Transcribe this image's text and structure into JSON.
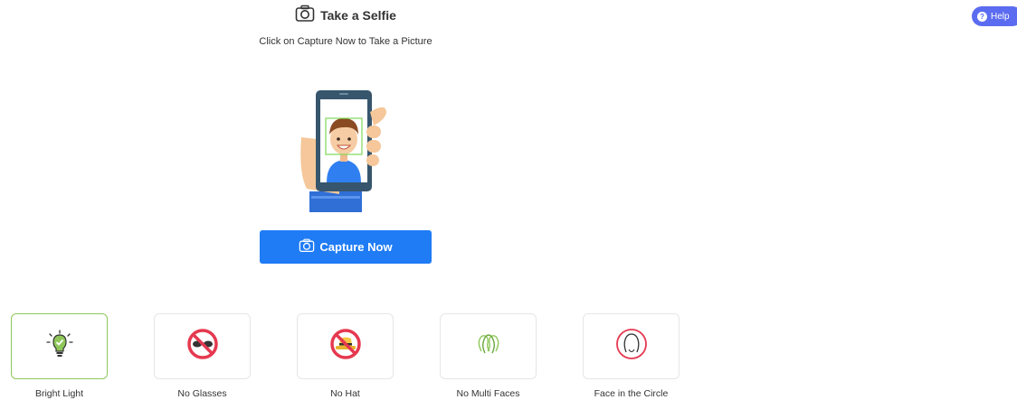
{
  "header": {
    "title": "Take a Selfie",
    "subtitle": "Click on Capture Now to Take a Picture",
    "title_icon": "camera-icon"
  },
  "help": {
    "label": "Help",
    "icon": "question-circle-icon",
    "color": "#5b6cf0"
  },
  "capture": {
    "label": "Capture Now",
    "icon": "camera-icon",
    "color": "#1f7cf5"
  },
  "tips": [
    {
      "label": "Bright Light",
      "icon": "lightbulb-check-icon",
      "selected": true
    },
    {
      "label": "No Glasses",
      "icon": "no-glasses-icon",
      "selected": false
    },
    {
      "label": "No Hat",
      "icon": "no-hat-icon",
      "selected": false
    },
    {
      "label": "No Multi Faces",
      "icon": "multi-faces-icon",
      "selected": false
    },
    {
      "label": "Face in the Circle",
      "icon": "face-circle-icon",
      "selected": false
    }
  ],
  "colors": {
    "accent_green": "#8fc75a",
    "prohibit_red": "#e53950"
  }
}
